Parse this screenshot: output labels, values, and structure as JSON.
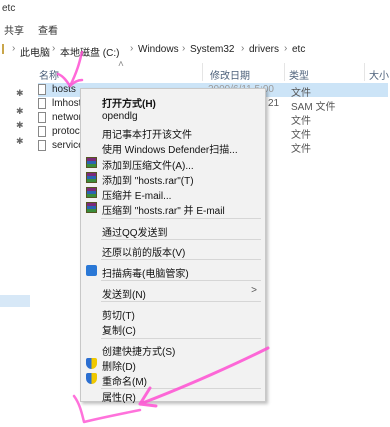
{
  "window": {
    "title": "etc"
  },
  "ribbon": {
    "tabs": [
      "共享",
      "查看"
    ]
  },
  "address": {
    "segments": [
      "此电脑",
      "本地磁盘 (C:)",
      "Windows",
      "System32",
      "drivers",
      "etc"
    ],
    "sep": "›"
  },
  "columns": {
    "name": "名称",
    "date": "修改日期",
    "type": "类型",
    "size": "大小"
  },
  "files": [
    {
      "name": "hosts",
      "date": "2009/6/11 5:00",
      "type": "文件"
    },
    {
      "name": "lmhosts",
      "date": "21",
      "type": "SAM 文件"
    },
    {
      "name": "networ",
      "date": "",
      "type": "文件"
    },
    {
      "name": "protoc",
      "date": "",
      "type": "文件"
    },
    {
      "name": "service",
      "date": "",
      "type": "文件"
    }
  ],
  "context_menu": {
    "open_with": "打开方式(H)",
    "opendlg": "opendlg",
    "open_notepad": "用记事本打开该文件",
    "defender": "使用 Windows Defender扫描...",
    "add_archive": "添加到压缩文件(A)...",
    "add_rar": "添加到 \"hosts.rar\"(T)",
    "compress_email": "压缩并 E-mail...",
    "compress_rar_email": "压缩到 \"hosts.rar\" 并 E-mail",
    "qq_send": "通过QQ发送到",
    "restore": "还原以前的版本(V)",
    "scan_virus": "扫描病毒(电脑管家)",
    "send_to": "发送到(N)",
    "cut": "剪切(T)",
    "copy": "复制(C)",
    "shortcut": "创建快捷方式(S)",
    "delete": "删除(D)",
    "rename": "重命名(M)",
    "properties": "属性(R)"
  },
  "colors": {
    "selection": "#cce4f7",
    "menu_bg": "#f2f2f2",
    "annotation": "#ff4fd2"
  }
}
